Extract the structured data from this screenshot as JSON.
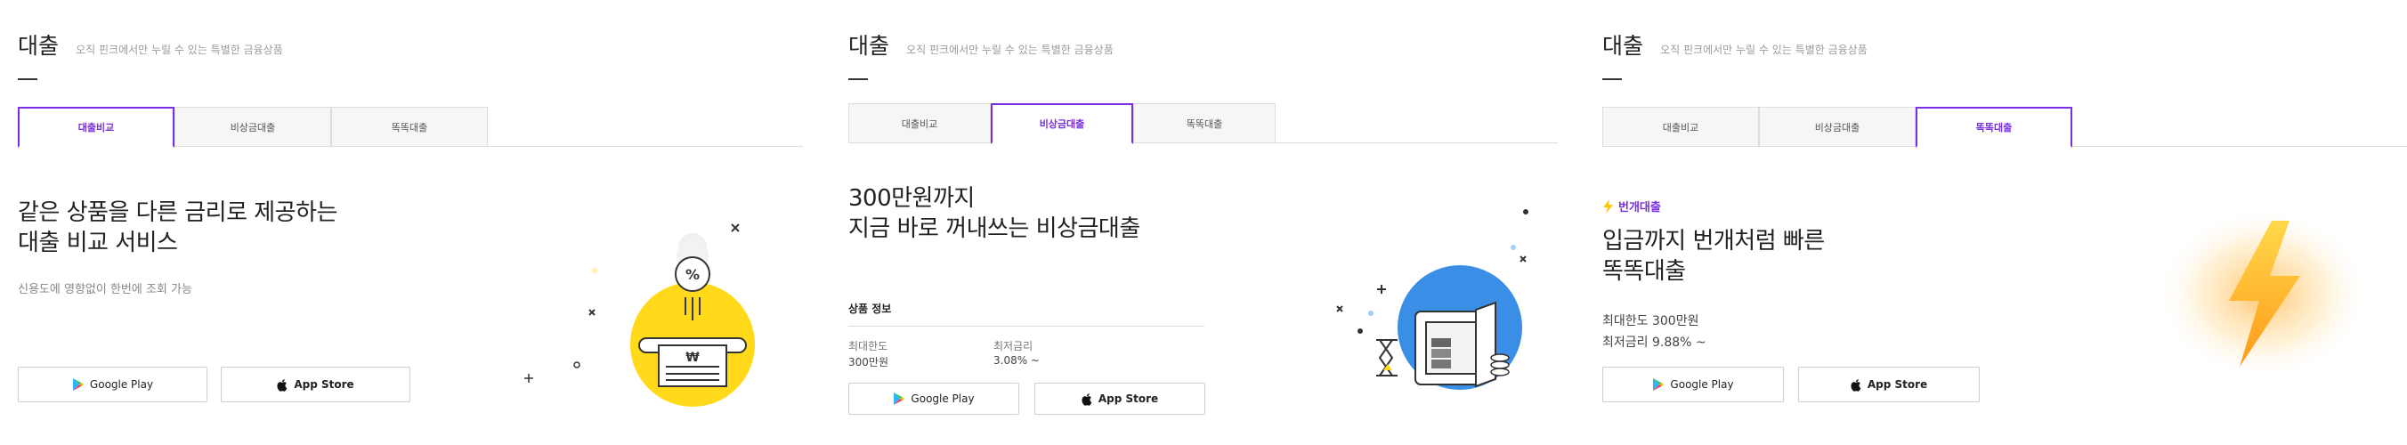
{
  "header": {
    "title": "대출",
    "subtitle": "오직 핀크에서만 누릴 수 있는 특별한 금융상품"
  },
  "tabs": [
    "대출비교",
    "비상금대출",
    "똑똑대출"
  ],
  "stores": {
    "google": "Google Play",
    "apple": "App Store"
  },
  "panel1": {
    "headline1": "같은 상품을 다른 금리로 제공하는",
    "headline2": "대출 비교 서비스",
    "desc": "신용도에 영향없이 한번에 조회 가능"
  },
  "panel2": {
    "headline1": "300만원까지",
    "headline2": "지금 바로 꺼내쓰는 비상금대출",
    "info_title": "상품 정보",
    "limit_label": "최대한도",
    "limit_value": "300만원",
    "rate_label": "최저금리",
    "rate_value": "3.08% ~"
  },
  "panel3": {
    "badge": "번개대출",
    "headline1": "입금까지 번개처럼 빠른",
    "headline2": "똑똑대출",
    "limit": "최대한도 300만원",
    "rate": "최저금리 9.88% ~"
  },
  "colors": {
    "accent": "#7a2ee6",
    "yellow": "#ffd91a",
    "blue": "#3b8ee6"
  }
}
